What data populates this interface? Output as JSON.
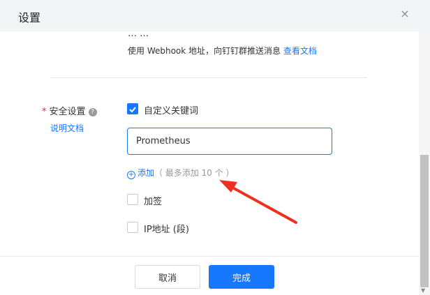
{
  "dialog": {
    "title": "设置",
    "close_icon": "×"
  },
  "webhook": {
    "partial_text": "… …",
    "text": "使用 Webhook 地址，向钉钉群推送消息",
    "link": "查看文档"
  },
  "security": {
    "required_mark": "*",
    "label": "安全设置",
    "help_icon": "?",
    "doc_link": "说明文档",
    "custom_keyword": {
      "label": "自定义关键词",
      "checked": true
    },
    "keyword_input": {
      "value": "Prometheus"
    },
    "add": {
      "plus": "+",
      "label": "添加",
      "hint": "（ 最多添加 10 个 ）"
    },
    "sign": {
      "label": "加签",
      "checked": false
    },
    "ip": {
      "label": "IP地址 (段)",
      "checked": false
    }
  },
  "footer": {
    "cancel": "取消",
    "done": "完成"
  },
  "colors": {
    "accent": "#1677ff",
    "arrow": "#f0301e",
    "required": "#f5222d"
  }
}
